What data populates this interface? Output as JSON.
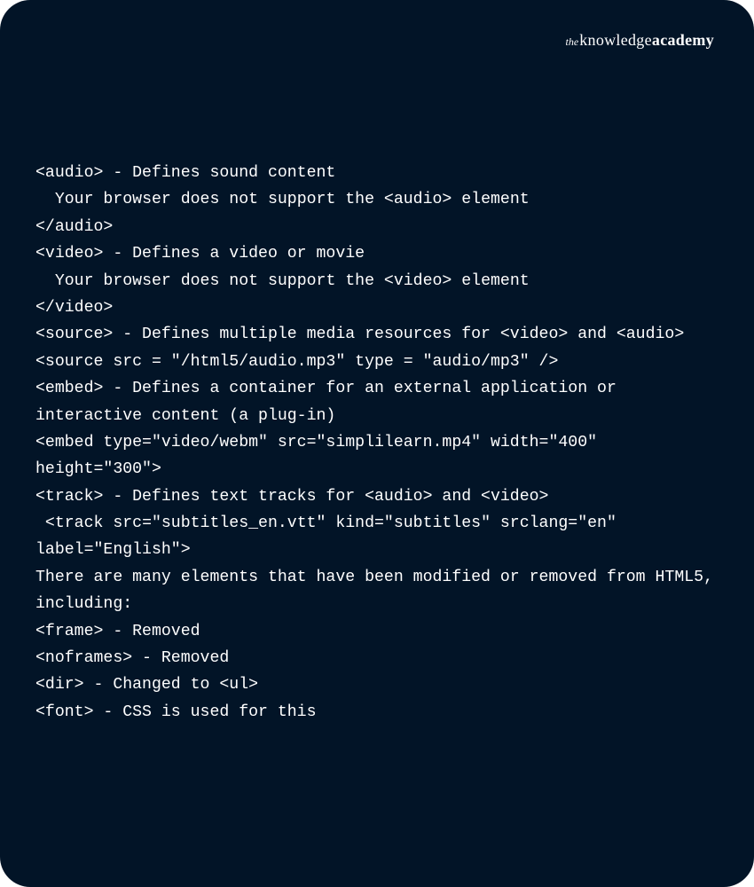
{
  "brand": {
    "the": "the",
    "knowledge": "knowledge",
    "academy": "academy"
  },
  "code_lines": [
    "<audio> - Defines sound content",
    "  Your browser does not support the <audio> element",
    "</audio>",
    "<video> - Defines a video or movie",
    "  Your browser does not support the <video> element",
    "</video>",
    "<source> - Defines multiple media resources for <video> and <audio>",
    "<source src = \"/html5/audio.mp3\" type = \"audio/mp3\" />",
    "<embed> - Defines a container for an external application or interactive content (a plug-in)",
    "<embed type=\"video/webm\" src=\"simplilearn.mp4\" width=\"400\" height=\"300\">",
    "<track> - Defines text tracks for <audio> and <video>",
    " <track src=\"subtitles_en.vtt\" kind=\"subtitles\" srclang=\"en\" label=\"English\">",
    "There are many elements that have been modified or removed from HTML5, including:",
    "<frame> - Removed",
    "<noframes> - Removed",
    "<dir> - Changed to <ul>",
    "<font> - CSS is used for this"
  ]
}
